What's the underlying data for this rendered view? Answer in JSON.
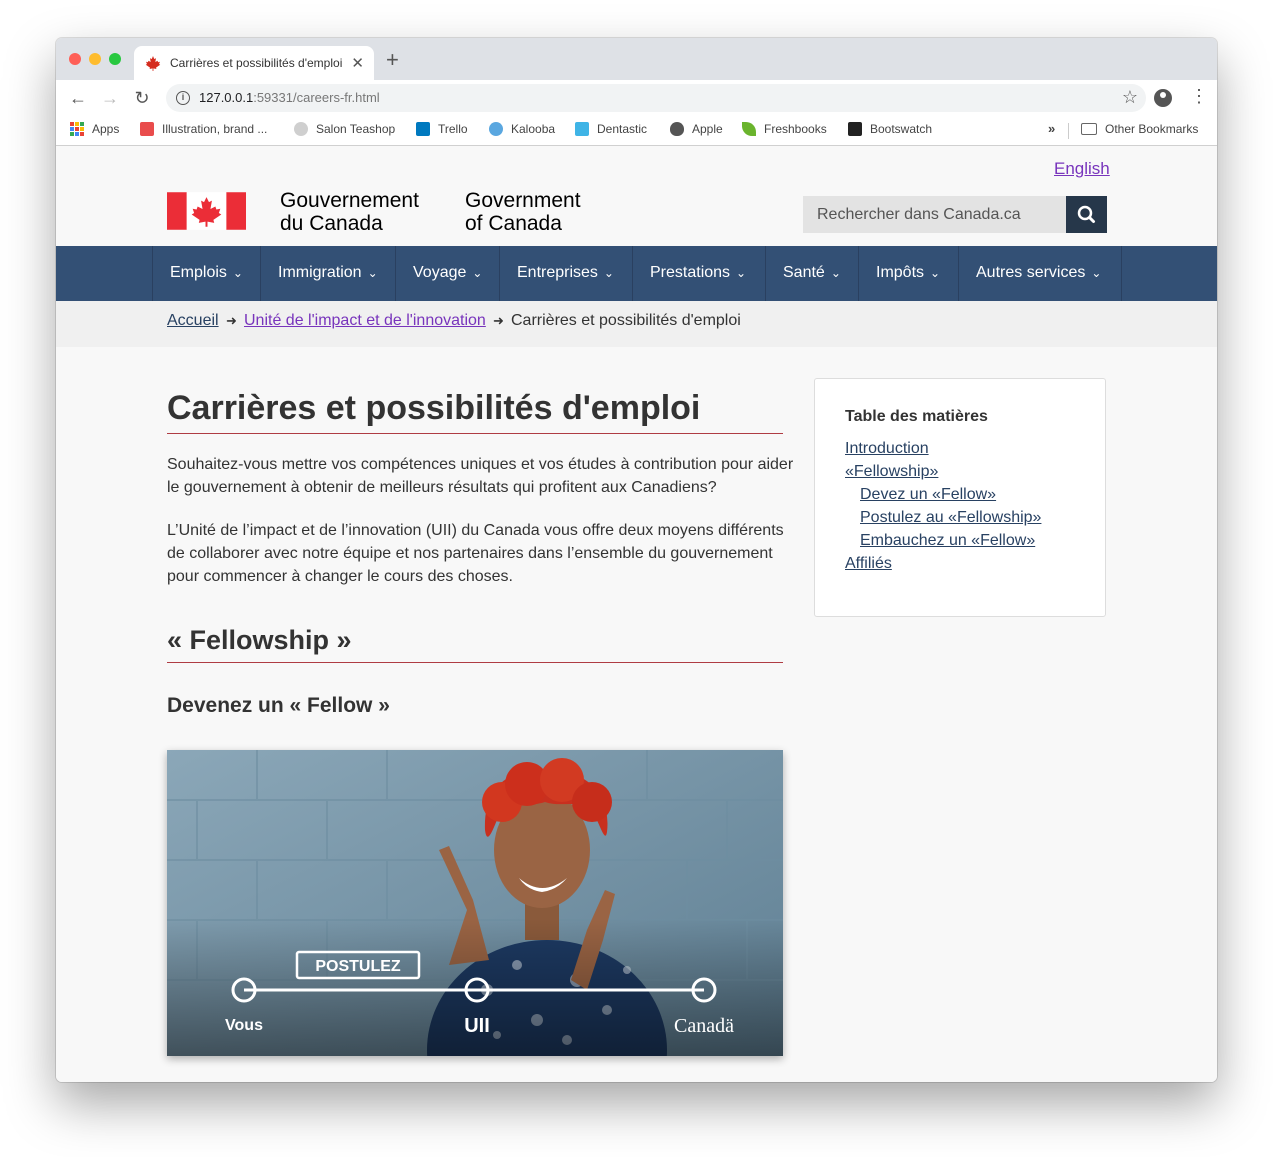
{
  "browser": {
    "tab_title": "Carrières et possibilités d'emploi",
    "url_host": "127.0.0.1",
    "url_rest": ":59331/careers-fr.html",
    "bookmarks": [
      "Apps",
      "Illustration, brand ...",
      "Salon Teashop",
      "Trello",
      "Kalooba",
      "Dentastic",
      "Apple",
      "Freshbooks",
      "Bootswatch"
    ],
    "bookmark_overflow": "»",
    "other_bookmarks": "Other Bookmarks"
  },
  "header": {
    "lang_toggle": "English",
    "signature_fr_line1": "Gouvernement",
    "signature_fr_line2": "du Canada",
    "signature_en_line1": "Government",
    "signature_en_line2": "of Canada",
    "search_placeholder": "Rechercher dans Canada.ca"
  },
  "nav": {
    "items": [
      "Emplois",
      "Immigration",
      "Voyage",
      "Entreprises",
      "Prestations",
      "Santé",
      "Impôts",
      "Autres services"
    ]
  },
  "breadcrumb": {
    "home": "Accueil",
    "parent": "Unité de l'impact et de l'innovation",
    "current": "Carrières et possibilités d'emploi"
  },
  "main": {
    "title": "Carrières et possibilités d'emploi",
    "intro_p1": "Souhaitez-vous mettre vos compétences uniques et vos études à contribution pour aider le gouvernement à obtenir de meilleurs résultats qui profitent aux Canadiens?",
    "intro_p2": "L’Unité de l’impact et de l’innovation (UII) du Canada vous offre deux moyens différents de collaborer avec notre équipe et nos partenaires dans l’ensemble du gouvernement pour commencer à changer le cours des choses.",
    "section_title": "« Fellowship »",
    "subsection_title": "Devenez un « Fellow »",
    "hero": {
      "apply_label": "POSTULEZ",
      "you_label": "Vous",
      "uii_label": "UII",
      "canada_label": "Canadä"
    }
  },
  "toc": {
    "title": "Table des matières",
    "items": [
      "Introduction",
      "«Fellowship»",
      "Devez un «Fellow»",
      "Postulez au «Fellowship»",
      "Embauchez un «Fellow»",
      "Affiliés"
    ]
  },
  "colors": {
    "nav_bg": "#335075",
    "search_btn": "#26374a",
    "link": "#284162",
    "visited_link": "#7834bc",
    "rule": "#af3c43",
    "flag_red": "#eb2d37"
  }
}
